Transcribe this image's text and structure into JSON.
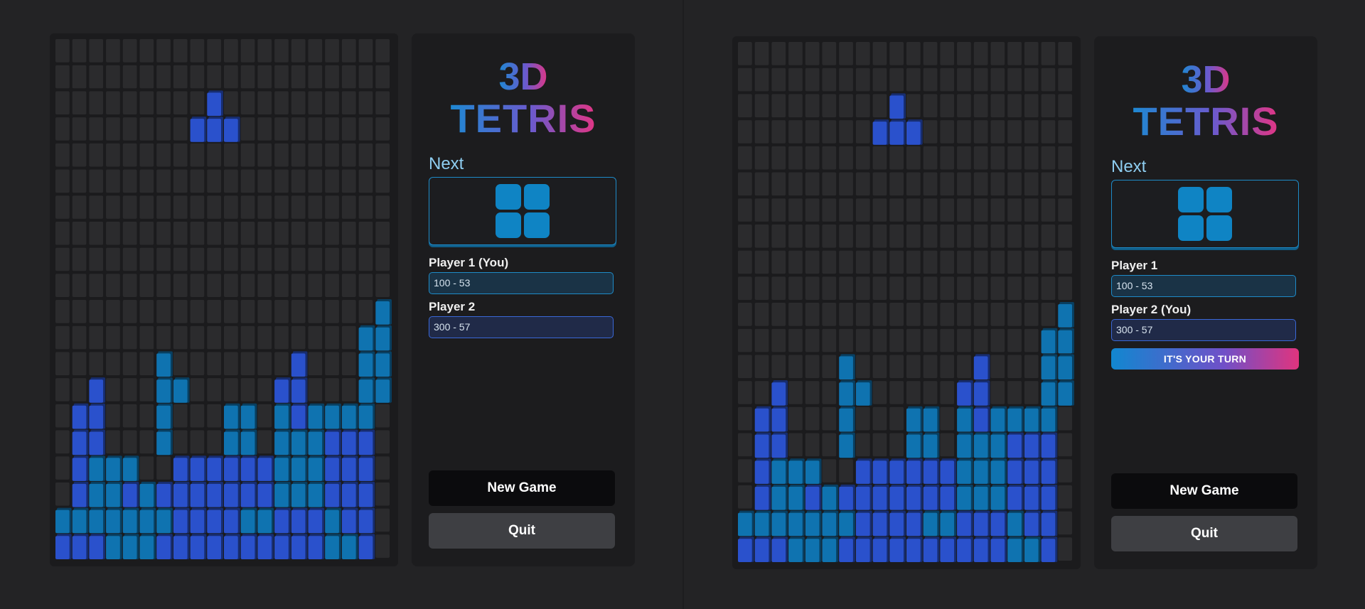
{
  "colors": {
    "page_background": "#232325",
    "board_background": "#1b1b1d",
    "empty_cell": "#2b2b2d",
    "block_blue": "#2a51cc",
    "block_teal": "#0f73b0",
    "next_piece": "#0f84c4",
    "accent_border": "#1e8bc8",
    "next_label": "#8ecdf0"
  },
  "board_cols": 20,
  "board_rows": 20,
  "board_rows_art": [
    "....................",
    "....................",
    ".........B..........",
    "........BBB.........",
    "....................",
    "....................",
    "....................",
    "....................",
    "....................",
    "....................",
    "...................T",
    "..................TT",
    "......T.......B...TT",
    "..B...TT.....BB...TT",
    ".BB...T...TT.TBTTTT.",
    ".BB...T...TT.TTTBBB.",
    ".BTTT..BBBBBBTTTBBB.",
    ".BTTBTBBBBBBBTTTBBB.",
    "TTTTTTTBBBBTTBBBTBB.",
    "BBBTTTBBBBBBBBBBTTB."
  ],
  "next_piece": {
    "name": "O",
    "cells": [
      [
        0,
        0
      ],
      [
        1,
        0
      ],
      [
        0,
        1
      ],
      [
        1,
        1
      ]
    ]
  },
  "views": [
    {
      "title_top": "3D",
      "title_bottom": "TETRIS",
      "next_label": "Next",
      "players": [
        {
          "label": "Player 1 (You)",
          "score": "100 - 53"
        },
        {
          "label": "Player 2",
          "score": "300 - 57"
        }
      ],
      "turn_badge": "",
      "new_game_label": "New Game",
      "quit_label": "Quit"
    },
    {
      "title_top": "3D",
      "title_bottom": "TETRIS",
      "next_label": "Next",
      "players": [
        {
          "label": "Player 1",
          "score": "100 - 53"
        },
        {
          "label": "Player 2 (You)",
          "score": "300 - 57"
        }
      ],
      "turn_badge": "IT'S YOUR TURN",
      "new_game_label": "New Game",
      "quit_label": "Quit"
    }
  ]
}
